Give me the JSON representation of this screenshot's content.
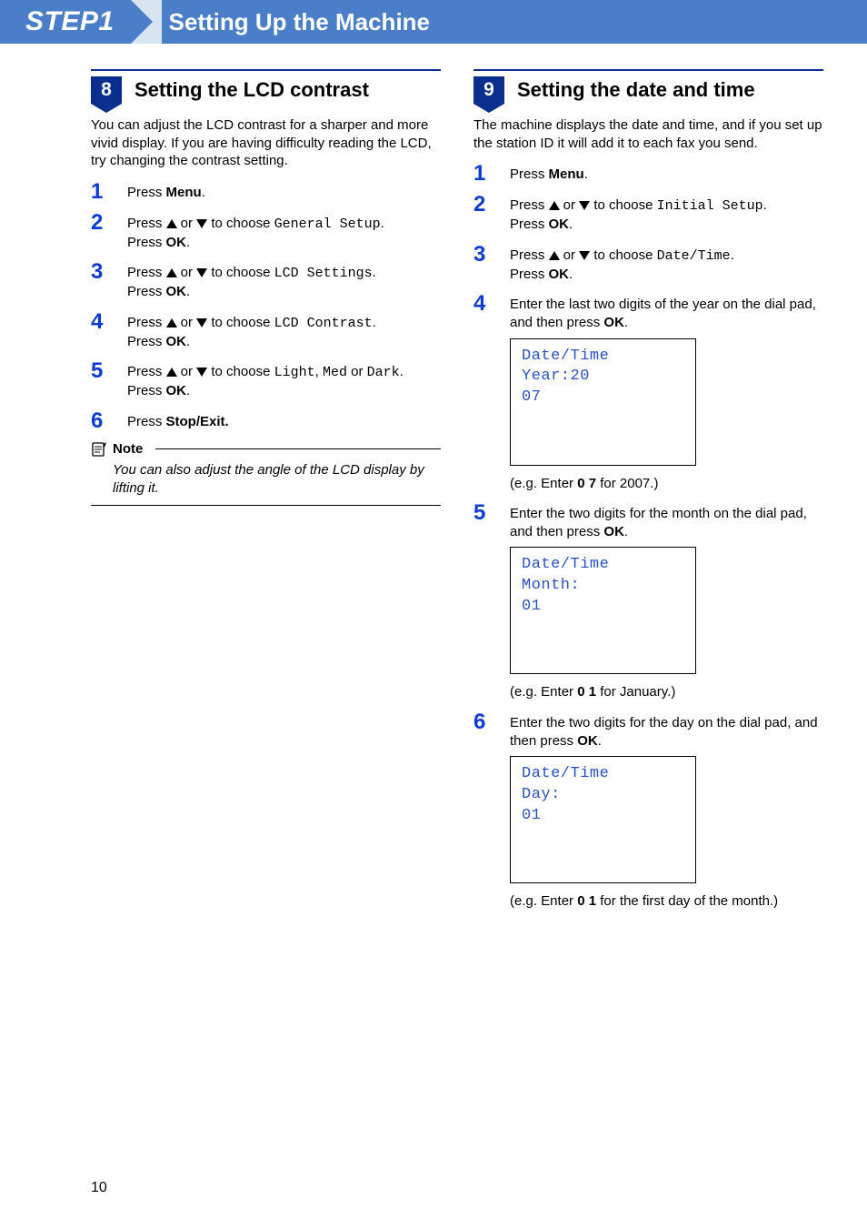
{
  "topbar": {
    "step_tag": "STEP1",
    "title": "Setting Up the Machine"
  },
  "page_number": "10",
  "left": {
    "sec_num": "8",
    "sec_title": "Setting the LCD contrast",
    "intro": "You can adjust the LCD contrast for a sharper and more vivid display. If you are having difficulty reading the LCD, try changing the contrast setting.",
    "steps": [
      {
        "n": "1",
        "pre": "Press ",
        "bold1": "Menu",
        "post": "."
      },
      {
        "n": "2",
        "pre": "Press ",
        "arrows": true,
        "mid": " to choose ",
        "mono1": "General Setup",
        "post1": ".",
        "br": true,
        "pre2": "Press ",
        "bold2": "OK",
        "post2": "."
      },
      {
        "n": "3",
        "pre": "Press ",
        "arrows": true,
        "mid": " to choose ",
        "mono1": "LCD Settings",
        "post1": ".",
        "br": true,
        "pre2": "Press ",
        "bold2": "OK",
        "post2": "."
      },
      {
        "n": "4",
        "pre": "Press ",
        "arrows": true,
        "mid": " to choose ",
        "mono1": "LCD Contrast",
        "post1": ".",
        "br": true,
        "pre2": "Press ",
        "bold2": "OK",
        "post2": "."
      },
      {
        "n": "5",
        "pre": "Press ",
        "arrows": true,
        "mid": " to choose ",
        "mono1": "Light",
        "post1a": ", ",
        "mono2": "Med",
        "post1b": " or ",
        "mono3": "Dark",
        "post1": ".",
        "br": true,
        "pre2": "Press ",
        "bold2": "OK",
        "post2": "."
      },
      {
        "n": "6",
        "pre": "Press ",
        "bold1": "Stop/Exit."
      }
    ],
    "note_label": "Note",
    "note_body": "You can also adjust the angle of the LCD display by lifting it."
  },
  "right": {
    "sec_num": "9",
    "sec_title": "Setting the date and time",
    "intro": "The machine displays the date and time, and if you set up the station ID it will add it to each fax you send.",
    "steps": [
      {
        "n": "1",
        "pre": "Press ",
        "bold1": "Menu",
        "post": "."
      },
      {
        "n": "2",
        "pre": "Press ",
        "arrows": true,
        "mid": " to choose ",
        "mono1": "Initial Setup",
        "post1": ".",
        "br": true,
        "pre2": "Press ",
        "bold2": "OK",
        "post2": "."
      },
      {
        "n": "3",
        "pre": "Press ",
        "arrows": true,
        "mid": " to choose ",
        "mono1": "Date/Time",
        "post1": ".",
        "br": true,
        "pre2": "Press ",
        "bold2": "OK",
        "post2": "."
      },
      {
        "n": "4",
        "plain": "Enter the last two digits of the year on the dial pad, and then press ",
        "bold": "OK",
        "post": ".",
        "lcd": "Date/Time\nYear:20\n07",
        "cap_pre": "(e.g. Enter ",
        "cap_bold": "0 7",
        "cap_post": " for 2007.)"
      },
      {
        "n": "5",
        "plain": "Enter the two digits for the month on the dial pad, and then press ",
        "bold": "OK",
        "post": ".",
        "lcd": "Date/Time\nMonth:\n01",
        "cap_pre": "(e.g. Enter ",
        "cap_bold": "0 1",
        "cap_post": " for January.)"
      },
      {
        "n": "6",
        "plain": "Enter the two digits for the day on the dial pad, and then press ",
        "bold": "OK",
        "post": ".",
        "lcd": "Date/Time\nDay:\n01",
        "cap_pre": "(e.g. Enter ",
        "cap_bold": "0 1",
        "cap_post": " for the first day of the month.)"
      }
    ]
  }
}
